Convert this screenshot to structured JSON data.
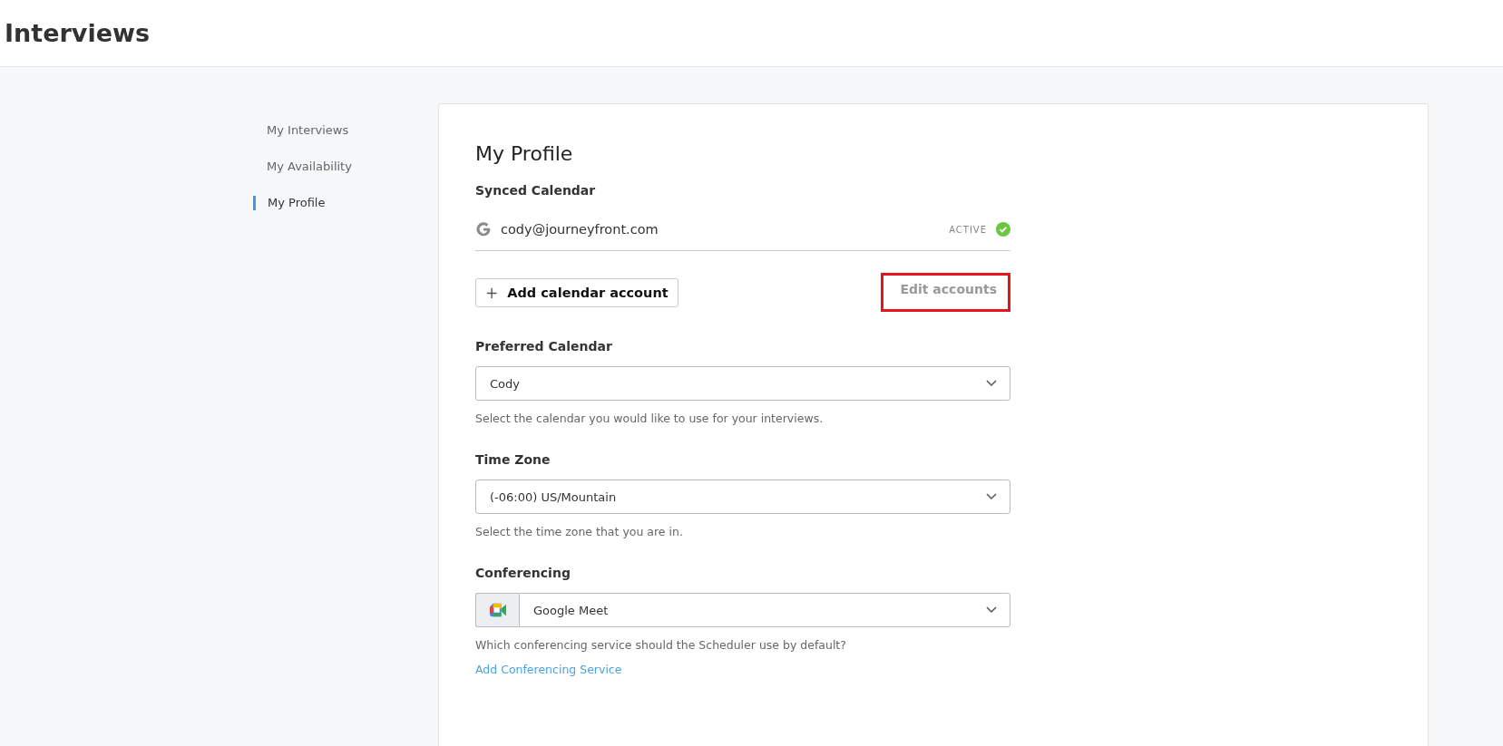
{
  "header": {
    "title": "Interviews"
  },
  "sidebar": {
    "items": [
      {
        "label": "My Interviews",
        "selected": false
      },
      {
        "label": "My Availability",
        "selected": false
      },
      {
        "label": "My Profile",
        "selected": true
      }
    ]
  },
  "profile": {
    "title": "My Profile",
    "synced_calendar": {
      "label": "Synced Calendar",
      "accounts": [
        {
          "email": "cody@journeyfront.com",
          "status": "ACTIVE",
          "active": true
        }
      ],
      "add_button": "Add calendar account",
      "add_icon": "+",
      "edit_link": {
        "label": "Edit accounts",
        "highlighted": true
      }
    },
    "fields": [
      {
        "kind": "select",
        "label": "Preferred Calendar",
        "value": "Cody",
        "help": "Select the calendar you would like to use for your interviews."
      },
      {
        "kind": "select",
        "label": "Time Zone",
        "value": "(-06:00) US/Mountain",
        "help": "Select the time zone that you are in."
      },
      {
        "kind": "conferencing",
        "label": "Conferencing",
        "value": "Google Meet",
        "help": "Which conferencing service should the Scheduler use by default?",
        "link": "Add Conferencing Service"
      }
    ]
  }
}
